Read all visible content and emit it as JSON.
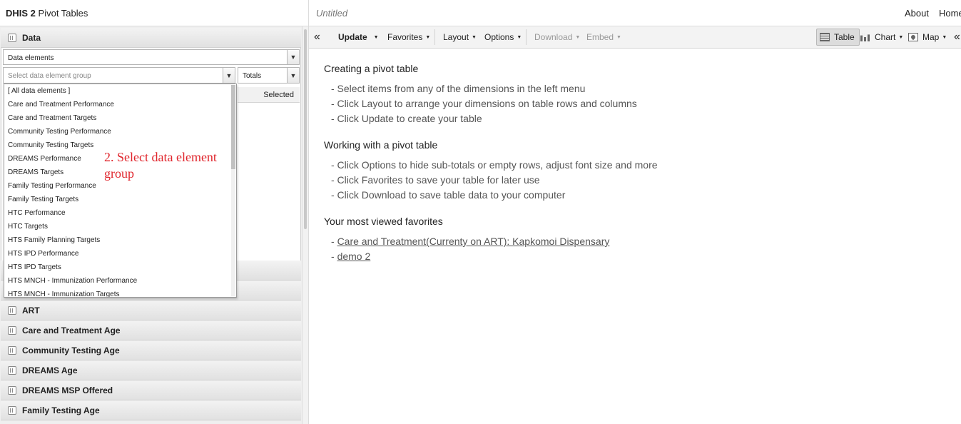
{
  "header": {
    "app_brand": "DHIS 2",
    "app_name": "Pivot Tables",
    "doc_title": "Untitled",
    "links": [
      "About",
      "Home"
    ]
  },
  "left": {
    "data_section": "Data",
    "data_type_select": "Data elements",
    "group_select_placeholder": "Select data element group",
    "totals_select": "Totals",
    "selected_header": "Selected",
    "group_options": [
      "[ All data elements ]",
      "Care and Treatment Performance",
      "Care and Treatment Targets",
      "Community Testing Performance",
      "Community Testing Targets",
      "DREAMS Performance",
      "DREAMS Targets",
      "Family Testing Performance",
      "Family Testing Targets",
      "HTC Performance",
      "HTC Targets",
      "HTS Family Planning Targets",
      "HTS IPD Performance",
      "HTS IPD Targets",
      "HTS MNCH - Immunization Performance",
      "HTS MNCH - Immunization Targets"
    ],
    "dimensions": [
      "ART",
      "Care and Treatment Age",
      "Community Testing Age",
      "DREAMS Age",
      "DREAMS MSP Offered",
      "Family Testing Age"
    ],
    "annotation": "2. Select data element group"
  },
  "toolbar": {
    "collapse_left": "«",
    "update": "Update",
    "favorites": "Favorites",
    "layout": "Layout",
    "options": "Options",
    "download": "Download",
    "embed": "Embed",
    "table": "Table",
    "chart": "Chart",
    "map": "Map",
    "collapse_right": "«"
  },
  "main": {
    "sections": [
      {
        "title": "Creating a pivot table",
        "lines": [
          "- Select items from any of the dimensions in the left menu",
          "- Click Layout to arrange your dimensions on table rows and columns",
          "- Click Update to create your table"
        ]
      },
      {
        "title": "Working with a pivot table",
        "lines": [
          "- Click Options to hide sub-totals or empty rows, adjust font size and more",
          "- Click Favorites to save your table for later use",
          "- Click Download to save table data to your computer"
        ]
      }
    ],
    "favorites_title": "Your most viewed favorites",
    "favorites": [
      "Care and Treatment(Currenty on ART): Kapkomoi Dispensary",
      "demo 2"
    ]
  }
}
